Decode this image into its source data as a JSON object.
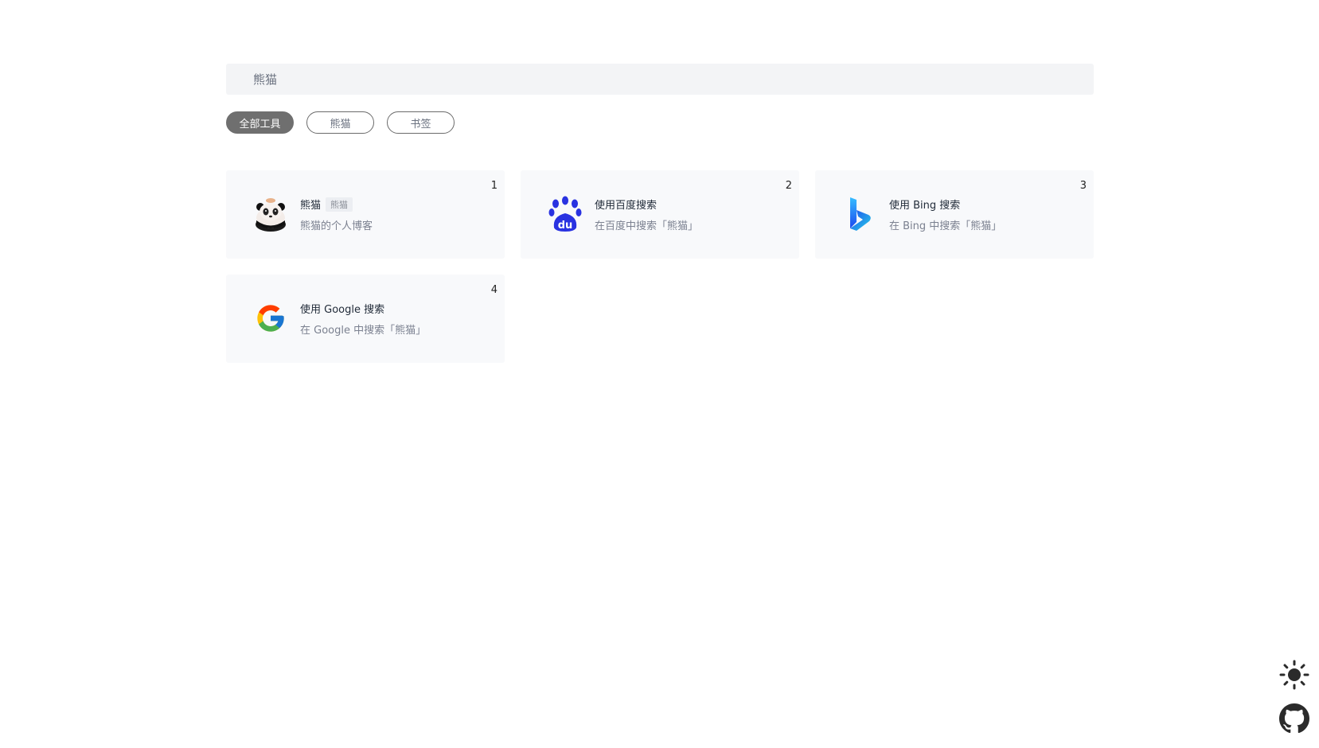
{
  "search": {
    "value": "熊猫"
  },
  "filters": [
    {
      "label": "全部工具",
      "active": true
    },
    {
      "label": "熊猫",
      "active": false
    },
    {
      "label": "书签",
      "active": false
    }
  ],
  "results": [
    {
      "index": "1",
      "title": "熊猫",
      "tag": "熊猫",
      "description": "熊猫的个人博客",
      "icon": "panda-icon"
    },
    {
      "index": "2",
      "title": "使用百度搜索",
      "description": "在百度中搜索「熊猫」",
      "icon": "baidu-icon"
    },
    {
      "index": "3",
      "title": "使用 Bing 搜索",
      "description": "在 Bing 中搜索「熊猫」",
      "icon": "bing-icon"
    },
    {
      "index": "4",
      "title": "使用 Google 搜索",
      "description": "在 Google 中搜索「熊猫」",
      "icon": "google-icon"
    }
  ],
  "sidebar_icons": [
    "theme-toggle-sun-icon",
    "github-icon"
  ],
  "colors": {
    "card_bg": "#f8f9fb",
    "search_bg": "#f3f4f6",
    "pill_active_bg": "#6f6f6f",
    "baidu_blue": "#2932e1"
  }
}
